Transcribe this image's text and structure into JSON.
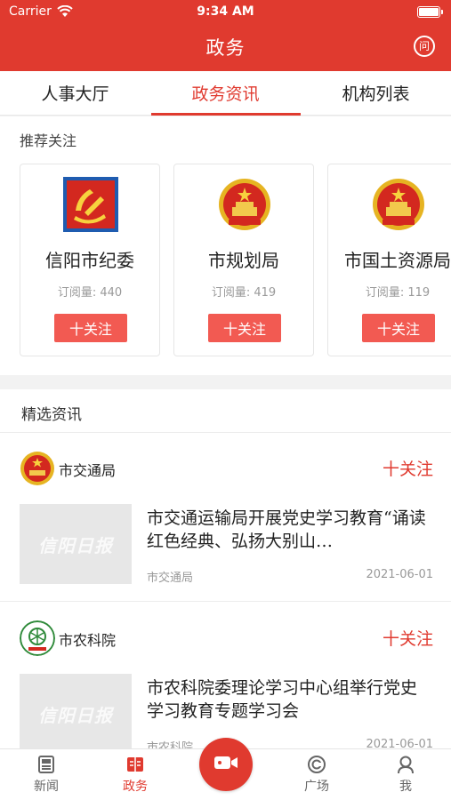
{
  "status_bar": {
    "carrier": "Carrier",
    "time": "9:34 AM"
  },
  "nav": {
    "title": "政务",
    "right_icon": "qa-icon",
    "right_icon_glyph": "问"
  },
  "tabs": [
    {
      "label": "人事大厅",
      "active": false
    },
    {
      "label": "政务资讯",
      "active": true
    },
    {
      "label": "机构列表",
      "active": false
    }
  ],
  "recommend": {
    "title": "推荐关注",
    "cards": [
      {
        "name": "信阳市纪委",
        "subscribers": "订阅量: 440",
        "follow_label": "十关注",
        "logo": "party-emblem-icon"
      },
      {
        "name": "市规划局",
        "subscribers": "订阅量: 419",
        "follow_label": "十关注",
        "logo": "national-emblem-icon"
      },
      {
        "name": "市国土资源局",
        "subscribers": "订阅量: 119",
        "follow_label": "十关注",
        "logo": "national-emblem-icon"
      }
    ]
  },
  "news": {
    "title": "精选资讯",
    "items": [
      {
        "source": "市交通局",
        "follow_label": "十关注",
        "headline": "市交通运输局开展党史学习教育“诵读红色经典、弘扬大别山…",
        "meta_source": "市交通局",
        "date": "2021-06-01",
        "thumb_text": "信阳日报",
        "logo": "national-emblem-icon"
      },
      {
        "source": "市农科院",
        "follow_label": "十关注",
        "headline": "市农科院委理论学习中心组举行党史学习教育专题学习会",
        "meta_source": "市农科院",
        "date": "2021-06-01",
        "thumb_text": "信阳日报",
        "logo": "academy-logo-icon"
      }
    ]
  },
  "bottom_nav": [
    {
      "label": "新闻",
      "icon": "news-icon",
      "active": false
    },
    {
      "label": "政务",
      "icon": "government-icon",
      "active": true
    },
    {
      "label": "",
      "icon": "video-camera-icon",
      "active": false
    },
    {
      "label": "广场",
      "icon": "plaza-icon",
      "active": false
    },
    {
      "label": "我",
      "icon": "profile-icon",
      "active": false
    }
  ],
  "colors": {
    "brand_red": "#e03a2f",
    "follow_button": "#f25a52",
    "muted_text": "#999999"
  }
}
